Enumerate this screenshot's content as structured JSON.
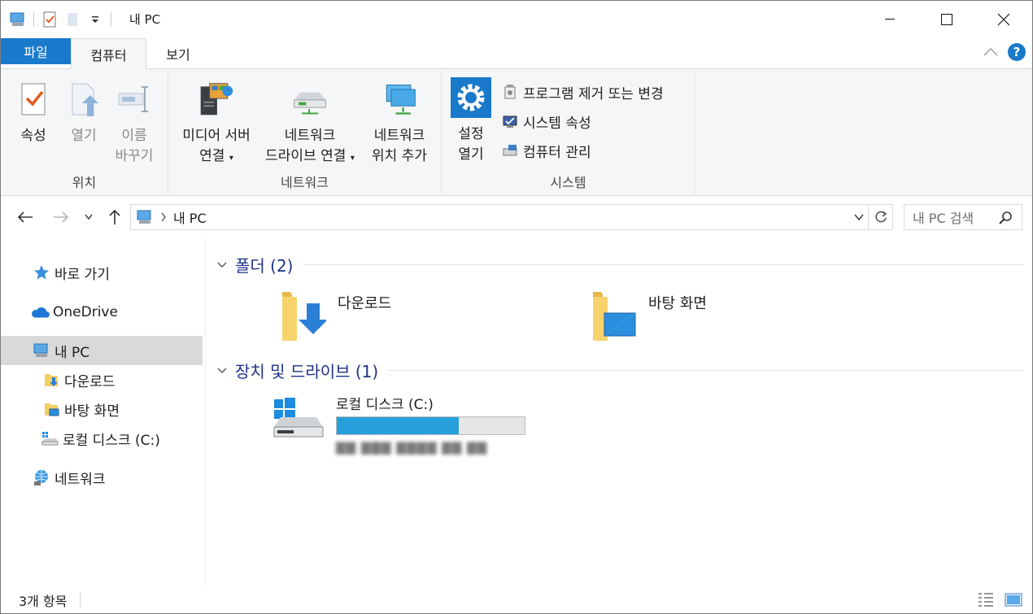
{
  "window": {
    "title": "내 PC"
  },
  "ribbon_tabs": {
    "file": "파일",
    "computer": "컴퓨터",
    "view": "보기"
  },
  "ribbon": {
    "location": {
      "label": "위치",
      "properties": "속성",
      "open": "열기",
      "rename_line1": "이름",
      "rename_line2": "바꾸기"
    },
    "network": {
      "label": "네트워크",
      "media_line1": "미디어 서버",
      "media_line2": "연결",
      "map_line1": "네트워크",
      "map_line2": "드라이브 연결",
      "add_line1": "네트워크",
      "add_line2": "위치 추가"
    },
    "system": {
      "label": "시스템",
      "settings_line1": "설정",
      "settings_line2": "열기",
      "uninstall": "프로그램 제거 또는 변경",
      "sys_props": "시스템 속성",
      "manage": "컴퓨터 관리"
    }
  },
  "address": {
    "path": "내 PC",
    "search_placeholder": "내 PC 검색"
  },
  "sidebar": {
    "quick_access": "바로 가기",
    "onedrive": "OneDrive",
    "this_pc": "내 PC",
    "downloads": "다운로드",
    "desktop": "바탕 화면",
    "local_disk": "로컬 디스크 (C:)",
    "network": "네트워크"
  },
  "content": {
    "folders_header": "폴더 (2)",
    "folders": [
      "다운로드",
      "바탕 화면"
    ],
    "devices_header": "장치 및 드라이브 (1)",
    "drive": {
      "name": "로컬 디스크 (C:)",
      "used_fraction": 0.65,
      "free_text": "▇▇ ▇▇▇ ▇▇▇▇ ▇▇ ▇▇"
    }
  },
  "status": {
    "count": "3개 항목"
  },
  "colors": {
    "accent": "#1979ca",
    "drive_fill": "#26a0da",
    "section_header": "#1e3287",
    "selected_bg": "#d9d9d9"
  }
}
